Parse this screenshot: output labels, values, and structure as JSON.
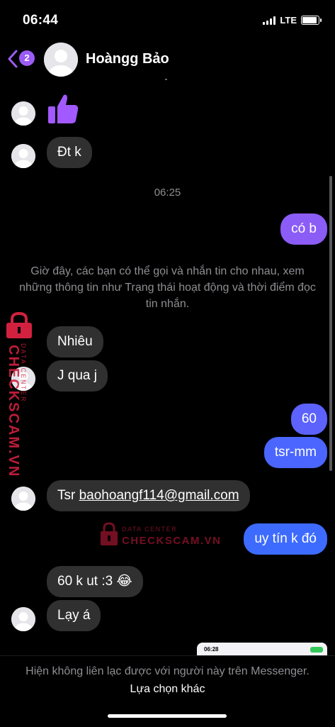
{
  "status_bar": {
    "time": "06:44",
    "network": "LTE"
  },
  "header": {
    "back_badge": "2",
    "contact_name": "Hoàngg Bảo"
  },
  "messages": [
    {
      "id": "m1",
      "kind": "incoming-sticker",
      "icon": "thumbs-up-icon"
    },
    {
      "id": "m2",
      "kind": "incoming",
      "text": "Đt k"
    },
    {
      "id": "ts1",
      "kind": "timestamp",
      "text": "06:25"
    },
    {
      "id": "m3",
      "kind": "outgoing",
      "text": "có b"
    },
    {
      "id": "sys1",
      "kind": "system",
      "text": "Giờ đây, các bạn có thể gọi và nhắn tin cho nhau, xem những thông tin như Trạng thái hoạt động và thời điểm đọc tin nhắn."
    },
    {
      "id": "m4",
      "kind": "incoming",
      "text": "Nhiêu"
    },
    {
      "id": "m5",
      "kind": "incoming",
      "text": "J qua j"
    },
    {
      "id": "m6",
      "kind": "outgoing",
      "text": "60"
    },
    {
      "id": "m7",
      "kind": "outgoing",
      "text": "tsr-mm"
    },
    {
      "id": "m8",
      "kind": "incoming",
      "prefix": "Tsr ",
      "link": "baohoangf114@gmail.com"
    },
    {
      "id": "m9",
      "kind": "outgoing",
      "text": "uy tín k đó"
    },
    {
      "id": "m10",
      "kind": "incoming",
      "text": "60 k ut :3 😂"
    },
    {
      "id": "m11",
      "kind": "incoming",
      "text": "Lạy á"
    }
  ],
  "watermark": {
    "brand": "CHECKSCAM.VN",
    "tag": "DATA CENTER"
  },
  "preview": {
    "time": "06:28"
  },
  "footer": {
    "text": "Hiện không liên lạc được với người này trên Messenger.",
    "action": "Lựa chọn khác"
  },
  "colors": {
    "accent": "#9b5cf5",
    "incoming_bubble": "#303030",
    "outgoing_gradient_top": "#8b5cf6",
    "outgoing_gradient_bottom": "#3b6bff",
    "watermark": "#d1213f"
  }
}
